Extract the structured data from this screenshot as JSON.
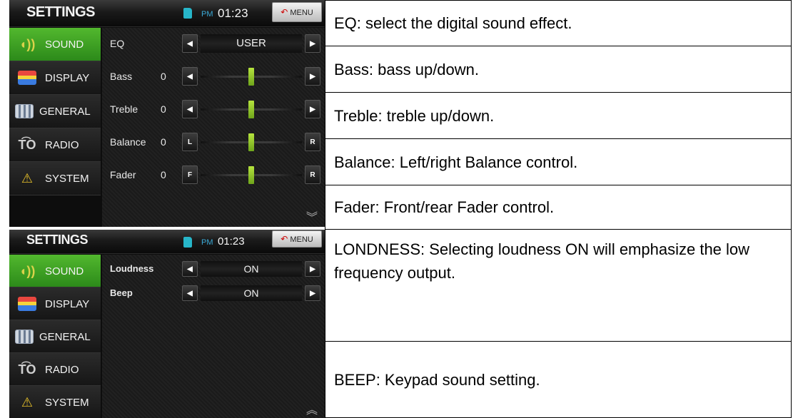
{
  "screens": [
    {
      "header": {
        "title": "SETTINGS",
        "ampm": "PM",
        "time": "01:23",
        "menu_label": "MENU"
      },
      "sidebar": [
        {
          "label": "SOUND",
          "icon": "speaker-icon",
          "active": true
        },
        {
          "label": "DISPLAY",
          "icon": "display-icon",
          "active": false
        },
        {
          "label": "GENERAL",
          "icon": "general-icon",
          "active": false
        },
        {
          "label": "RADIO",
          "icon": "radio-icon",
          "active": false
        },
        {
          "label": "SYSTEM",
          "icon": "system-icon",
          "active": false
        }
      ],
      "rows": [
        {
          "label": "EQ",
          "value": "USER",
          "type": "value",
          "left_btn": "◀",
          "right_btn": "▶"
        },
        {
          "label": "Bass",
          "num": "0",
          "type": "slider",
          "left_btn": "◀",
          "right_btn": "▶",
          "level": 0.5
        },
        {
          "label": "Treble",
          "num": "0",
          "type": "slider",
          "left_btn": "◀",
          "right_btn": "▶",
          "level": 0.5
        },
        {
          "label": "Balance",
          "num": "0",
          "type": "slider",
          "left_btn": "L",
          "right_btn": "R",
          "level": 0.5
        },
        {
          "label": "Fader",
          "num": "0",
          "type": "slider",
          "left_btn": "F",
          "right_btn": "R",
          "level": 0.5
        }
      ],
      "scroll_chevron": "︾"
    },
    {
      "header": {
        "title": "SETTINGS",
        "ampm": "PM",
        "time": "01:23",
        "menu_label": "MENU"
      },
      "sidebar": [
        {
          "label": "SOUND",
          "icon": "speaker-icon",
          "active": true
        },
        {
          "label": "DISPLAY",
          "icon": "display-icon",
          "active": false
        },
        {
          "label": "GENERAL",
          "icon": "general-icon",
          "active": false
        },
        {
          "label": "RADIO",
          "icon": "radio-icon",
          "active": false
        },
        {
          "label": "SYSTEM",
          "icon": "system-icon",
          "active": false
        }
      ],
      "rows": [
        {
          "label": "Loudness",
          "value": "ON",
          "type": "value",
          "left_btn": "◀",
          "right_btn": "▶"
        },
        {
          "label": "Beep",
          "value": "ON",
          "type": "value",
          "left_btn": "◀",
          "right_btn": "▶"
        }
      ],
      "scroll_chevron": "︽"
    }
  ],
  "descriptions": [
    "EQ: select the digital sound effect.",
    "Bass: bass up/down.",
    "Treble: treble up/down.",
    "Balance: Left/right Balance control.",
    "Fader: Front/rear Fader control.",
    "LONDNESS: Selecting loudness ON will emphasize the low frequency output.",
    "BEEP: Keypad sound setting."
  ],
  "colors": {
    "active_tab": "#3fa224",
    "slider_thumb": "#9fd13a",
    "time_accent": "#3aa9d6",
    "menu_back_arrow": "#cc0000"
  }
}
